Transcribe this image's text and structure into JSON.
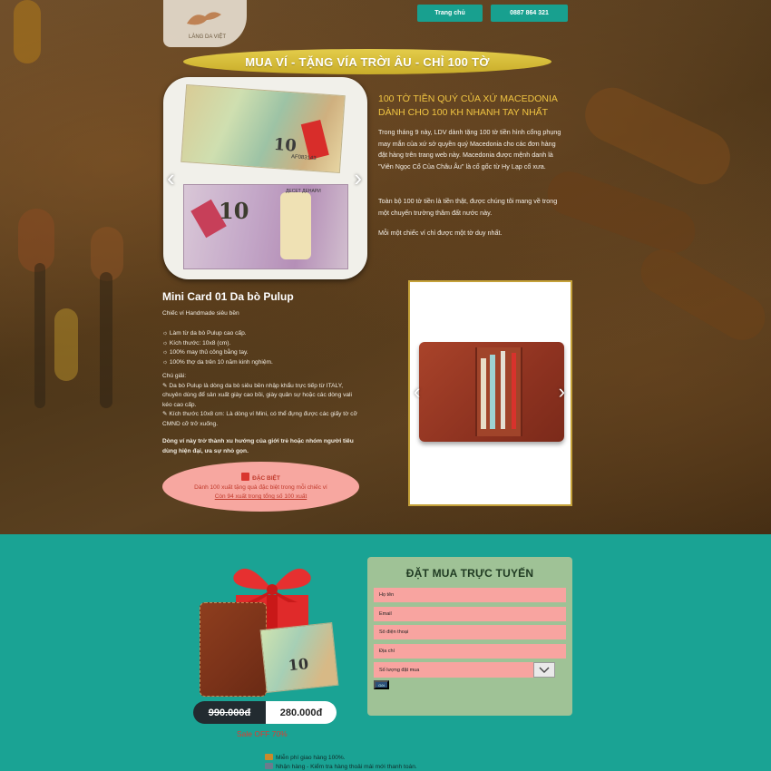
{
  "header": {
    "logo_text": "LÀNG DA VIỆT",
    "nav": {
      "home": "Trang chủ",
      "phone": "0887 864 321"
    }
  },
  "banner": {
    "title": "MUA VÍ - TẶNG VÍA TRỜI ÂU - CHỈ 100 TỜ"
  },
  "info": {
    "title_line1": "100 TỜ TIỀN QUÝ CỦA XỨ MACEDONIA",
    "title_line2": "DÀNH CHO 100 KH NHANH TAY NHẤT",
    "para1": "Trong tháng 9 này, LDV dành tặng 100 tờ tiền hình cổng phụng may mắn của xứ sở quyền quý Macedonia cho các đơn hàng đặt hàng trên trang web này. Macedonia được mệnh danh là \"Viên Ngọc Cổ Của Châu Âu\" là cố gốc từ Hy Lạp cổ xưa.",
    "para2": "Toàn bộ 100 tờ tiền là tiền thật, được chúng tôi mang về trong một chuyến trường thăm đất nước này.",
    "para3": "Mỗi một chiếc ví chỉ được một tờ duy nhất."
  },
  "product": {
    "title": "Mini Card 01 Da bò Pulup",
    "subtitle": "Chiếc ví Handmade siêu bền",
    "features": [
      "Làm từ da bò Pulup cao cấp.",
      "Kích thước: 10x8 (cm).",
      "100% may thủ công bằng tay.",
      "100% thợ da trên 10 năm kinh nghiệm."
    ],
    "notes_title": "Chú giải:",
    "note1": "Da bò Pulup là dòng da bò siêu bền nhập khẩu trực tiếp từ ITALY, chuyên dùng để sản xuất giày cao bồi, giày quân sự hoặc các dòng vali kéo cao cấp.",
    "note2": "Kích thước 10x8 cm: Là dòng ví Mini, có thể đựng được các giấy tờ cỡ CMND cỡ trở xuống.",
    "closing": "Dòng ví này trở thành xu hướng của giới trẻ hoặc nhóm người tiêu dùng hiện đại, ưa sự nhỏ gọn."
  },
  "special": {
    "title": "ĐẶC BIỆT",
    "line1": "Dành 100 xuất tặng quà đặc biệt trong mỗi chiếc ví",
    "line2": "Còn 94 xuất trong tổng số 100 xuất"
  },
  "note_labels": {
    "top_serial": "AF083143",
    "bottom_caption": "ДЕСЕТ ДЕНАРИ",
    "denomination": "10"
  },
  "pricing": {
    "old_price": "990.000đ",
    "new_price": "280.000đ",
    "sale": "Sale OFF 70%"
  },
  "form": {
    "title": "ĐẶT MUA TRỰC TUYẾN",
    "name_placeholder": "Họ tên",
    "email_placeholder": "Email",
    "phone_placeholder": "Số điện thoại",
    "address_placeholder": "Địa chỉ",
    "quantity_label": "Số lượng đặt mua",
    "submit_label": "Gửi"
  },
  "perks": {
    "free_ship": "Miễn phí giao hàng 100%.",
    "cod": "Nhận hàng - Kiểm tra hàng thoải mái mới thanh toán."
  },
  "colors": {
    "teal": "#1aa394",
    "banner_gold": "#d7bd3a",
    "title_gold": "#f0c542",
    "form_green": "#9fc296",
    "field_pink": "#f8a4a0",
    "special_pink": "#f7a7a0",
    "sale_red": "#e23a2f"
  },
  "icons": [
    "gift-icon",
    "chevron-left-icon",
    "chevron-right-icon",
    "chevron-down-icon",
    "truck-icon",
    "package-icon",
    "bullet-icon",
    "pen-icon"
  ]
}
